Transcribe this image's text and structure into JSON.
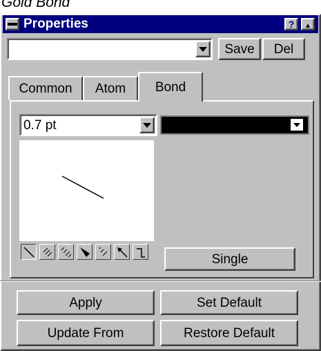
{
  "caption": "Gold Bond",
  "window": {
    "title": "Properties",
    "help_label": "?",
    "collapse_label": "▲"
  },
  "style_row": {
    "style_value": "",
    "save_label": "Save",
    "del_label": "Del"
  },
  "tabs": [
    {
      "label": "Common",
      "active": false
    },
    {
      "label": "Atom",
      "active": false
    },
    {
      "label": "Bond",
      "active": true
    }
  ],
  "bond": {
    "width_value": "0.7 pt",
    "color_value": "#000000",
    "bond_types": [
      "plain",
      "hashed",
      "dashed",
      "wedge",
      "hashed-wedge",
      "arrow",
      "crossed"
    ],
    "selected_type": "plain",
    "type_label": "Single"
  },
  "actions": {
    "apply_label": "Apply",
    "set_default_label": "Set Default",
    "update_from_label": "Update From",
    "restore_default_label": "Restore Default"
  }
}
